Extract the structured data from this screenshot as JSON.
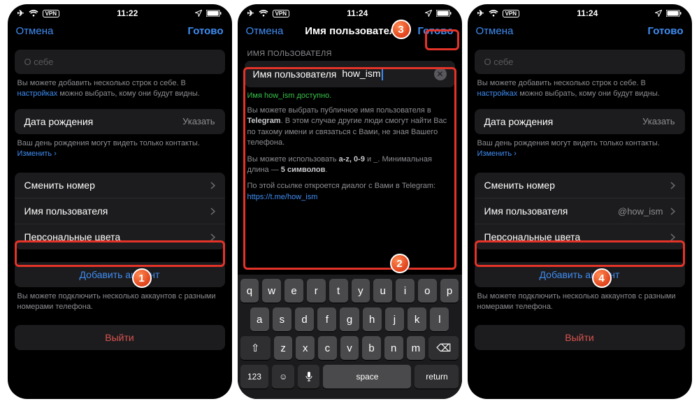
{
  "status": {
    "time1": "11:22",
    "time2": "11:24",
    "time3": "11:24"
  },
  "nav": {
    "cancel": "Отмена",
    "done": "Готово",
    "title_user": "Имя пользовател"
  },
  "s1": {
    "about_placeholder": "О себе",
    "about_hint_a": "Вы можете добавить несколько строк о себе. В ",
    "about_hint_link": "настройках",
    "about_hint_b": " можно выбрать, кому они будут видны.",
    "dob_label": "Дата рождения",
    "dob_value": "Указать",
    "dob_hint_a": "Ваш день рождения могут видеть только контакты. ",
    "dob_hint_link": "Изменить ",
    "change_number": "Сменить номер",
    "username_label": "Имя пользователя",
    "colors": "Персональные цвета",
    "add_account": "Добавить аккаунт",
    "multi_hint": "Вы можете подключить несколько аккаунтов с разными номерами телефона.",
    "logout": "Выйти"
  },
  "s2": {
    "section": "ИМЯ ПОЛЬЗОВАТЕЛЯ",
    "field_label": "Имя пользователя",
    "field_value": "how_ism",
    "ok": "Имя how_ism доступно.",
    "d1a": "Вы можете выбрать публичное имя пользователя в ",
    "d1b": "Telegram",
    "d1c": ". В этом случае другие люди смогут найти Вас по такому имени и связаться с Вами, не зная Вашего телефона.",
    "d2a": "Вы можете использовать ",
    "d2b": "a-z, 0-9",
    "d2c": " и ",
    "d2d": "_",
    "d2e": ". Минимальная длина — ",
    "d2f": "5 символов",
    "d2g": ".",
    "d3a": "По этой ссылке откроется диалог с Вами в Telegram:",
    "d3link": "https://t.me/how_ism"
  },
  "s3": {
    "username_value": "@how_ism"
  },
  "kbd": {
    "row1": [
      "q",
      "w",
      "e",
      "r",
      "t",
      "y",
      "u",
      "i",
      "o",
      "p"
    ],
    "row2": [
      "a",
      "s",
      "d",
      "f",
      "g",
      "h",
      "j",
      "k",
      "l"
    ],
    "row3": [
      "z",
      "x",
      "c",
      "v",
      "b",
      "n",
      "m"
    ],
    "n123": "123",
    "space": "space",
    "return": "return"
  },
  "badges": {
    "b1": "1",
    "b2": "2",
    "b3": "3",
    "b4": "4"
  }
}
